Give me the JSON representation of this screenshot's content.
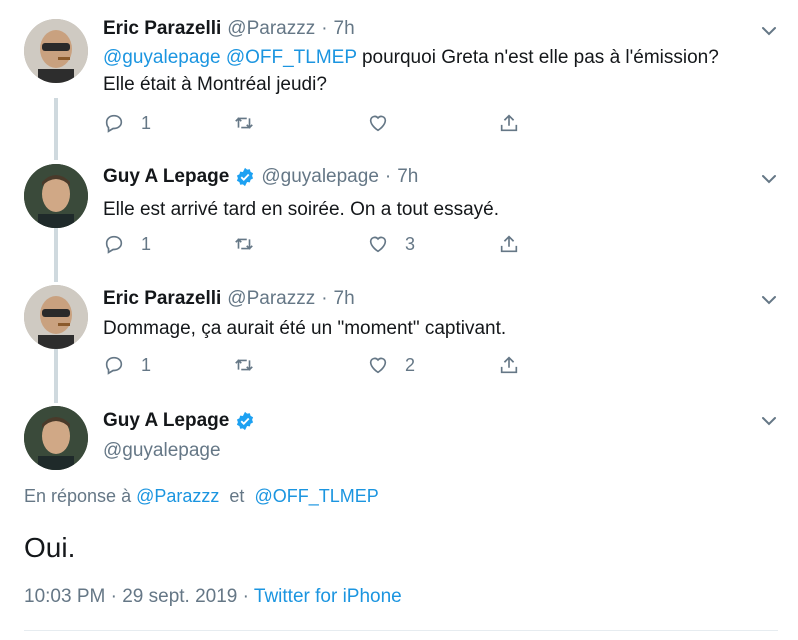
{
  "tweets": [
    {
      "name": "Eric Parazelli",
      "handle": "@Parazzz",
      "time": "7h",
      "mentions": [
        "@guyalepage",
        "@OFF_TLMEP"
      ],
      "text": " pourquoi Greta n'est elle pas à l'émission? Elle était à Montréal jeudi?",
      "reply_count": "1",
      "retweet_count": "",
      "like_count": ""
    },
    {
      "name": "Guy A Lepage",
      "handle": "@guyalepage",
      "time": "7h",
      "text": "Elle est arrivé tard en soirée. On a tout essayé.",
      "reply_count": "1",
      "retweet_count": "",
      "like_count": "3"
    },
    {
      "name": "Eric Parazelli",
      "handle": "@Parazzz",
      "time": "7h",
      "text": "Dommage, ça aurait été un \"moment\" captivant.",
      "reply_count": "1",
      "retweet_count": "",
      "like_count": "2"
    }
  ],
  "main_tweet": {
    "name": "Guy A Lepage",
    "handle": "@guyalepage",
    "reply_prefix": "En réponse à",
    "reply_to_1": "@Parazzz",
    "reply_and": "et",
    "reply_to_2": "@OFF_TLMEP",
    "text": "Oui.",
    "timestamp": "10:03 PM · 29 sept. 2019 ·",
    "source": "Twitter for iPhone"
  },
  "colors": {
    "link": "#1b95e0",
    "muted": "#657786",
    "verified": "#1da1f2",
    "thread_line": "#cfd9de"
  }
}
